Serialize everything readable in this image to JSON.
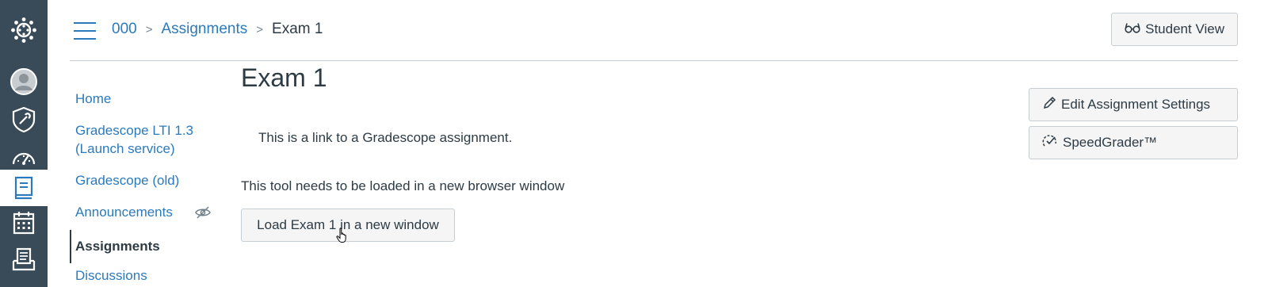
{
  "global_nav": [
    {
      "icon": "canvas-logo-icon"
    },
    {
      "icon": "account-icon"
    },
    {
      "icon": "admin-icon"
    },
    {
      "icon": "dashboard-icon"
    },
    {
      "icon": "courses-icon",
      "active": true
    },
    {
      "icon": "calendar-icon"
    },
    {
      "icon": "inbox-icon"
    }
  ],
  "breadcrumb": {
    "course": "000",
    "section": "Assignments",
    "current": "Exam 1",
    "separator": ">"
  },
  "header": {
    "student_view_label": "Student View"
  },
  "course_nav": {
    "items": [
      {
        "label": "Home"
      },
      {
        "label": "Gradescope LTI 1.3 (Launch service)"
      },
      {
        "label": "Gradescope (old)"
      },
      {
        "label": "Announcements",
        "hidden_icon": "eye-slash-icon"
      },
      {
        "label": "Assignments",
        "active": true
      },
      {
        "label": "Discussions"
      }
    ]
  },
  "main": {
    "title": "Exam 1",
    "description": "This is a link to a Gradescope assignment.",
    "tool_note": "This tool needs to be loaded in a new browser window",
    "load_button_label": "Load Exam 1 in a new window"
  },
  "sidebar": {
    "edit_settings_label": "Edit Assignment Settings",
    "speedgrader_label": "SpeedGrader™"
  },
  "colors": {
    "nav_bg": "#394b58",
    "link": "#2b7abc",
    "text": "#2d3b45",
    "button_bg": "#f5f5f5",
    "border": "#c7cdd1"
  }
}
